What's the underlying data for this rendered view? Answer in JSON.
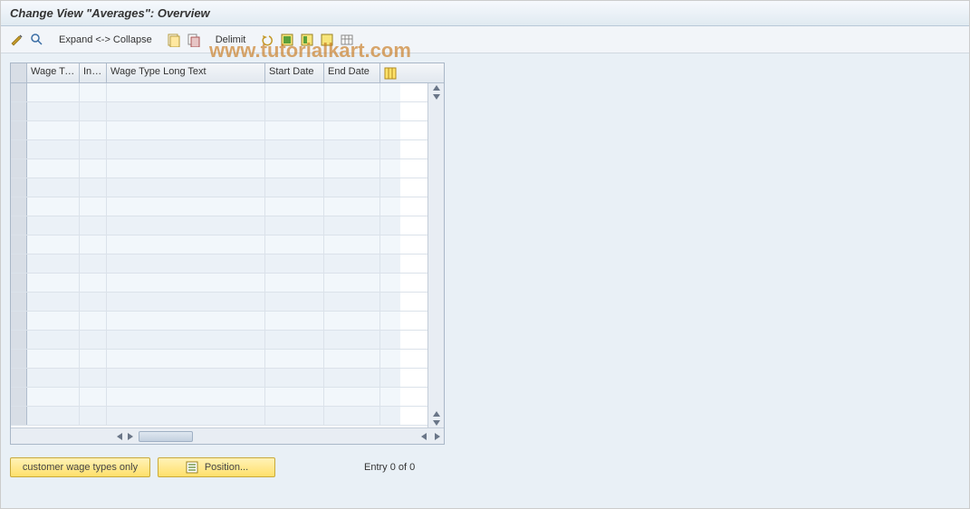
{
  "title": "Change View \"Averages\": Overview",
  "toolbar": {
    "expand_collapse": "Expand <-> Collapse",
    "delimit": "Delimit"
  },
  "watermark": {
    "left": "www.tut",
    "right": "orialkart.com"
  },
  "table": {
    "columns": {
      "c1": "Wage Ty...",
      "c2": "Inf...",
      "c3": "Wage Type Long Text",
      "c4": "Start Date",
      "c5": "End Date"
    }
  },
  "buttons": {
    "customer_only": "customer wage types only",
    "position": "Position..."
  },
  "status": {
    "entry": "Entry 0 of 0"
  }
}
